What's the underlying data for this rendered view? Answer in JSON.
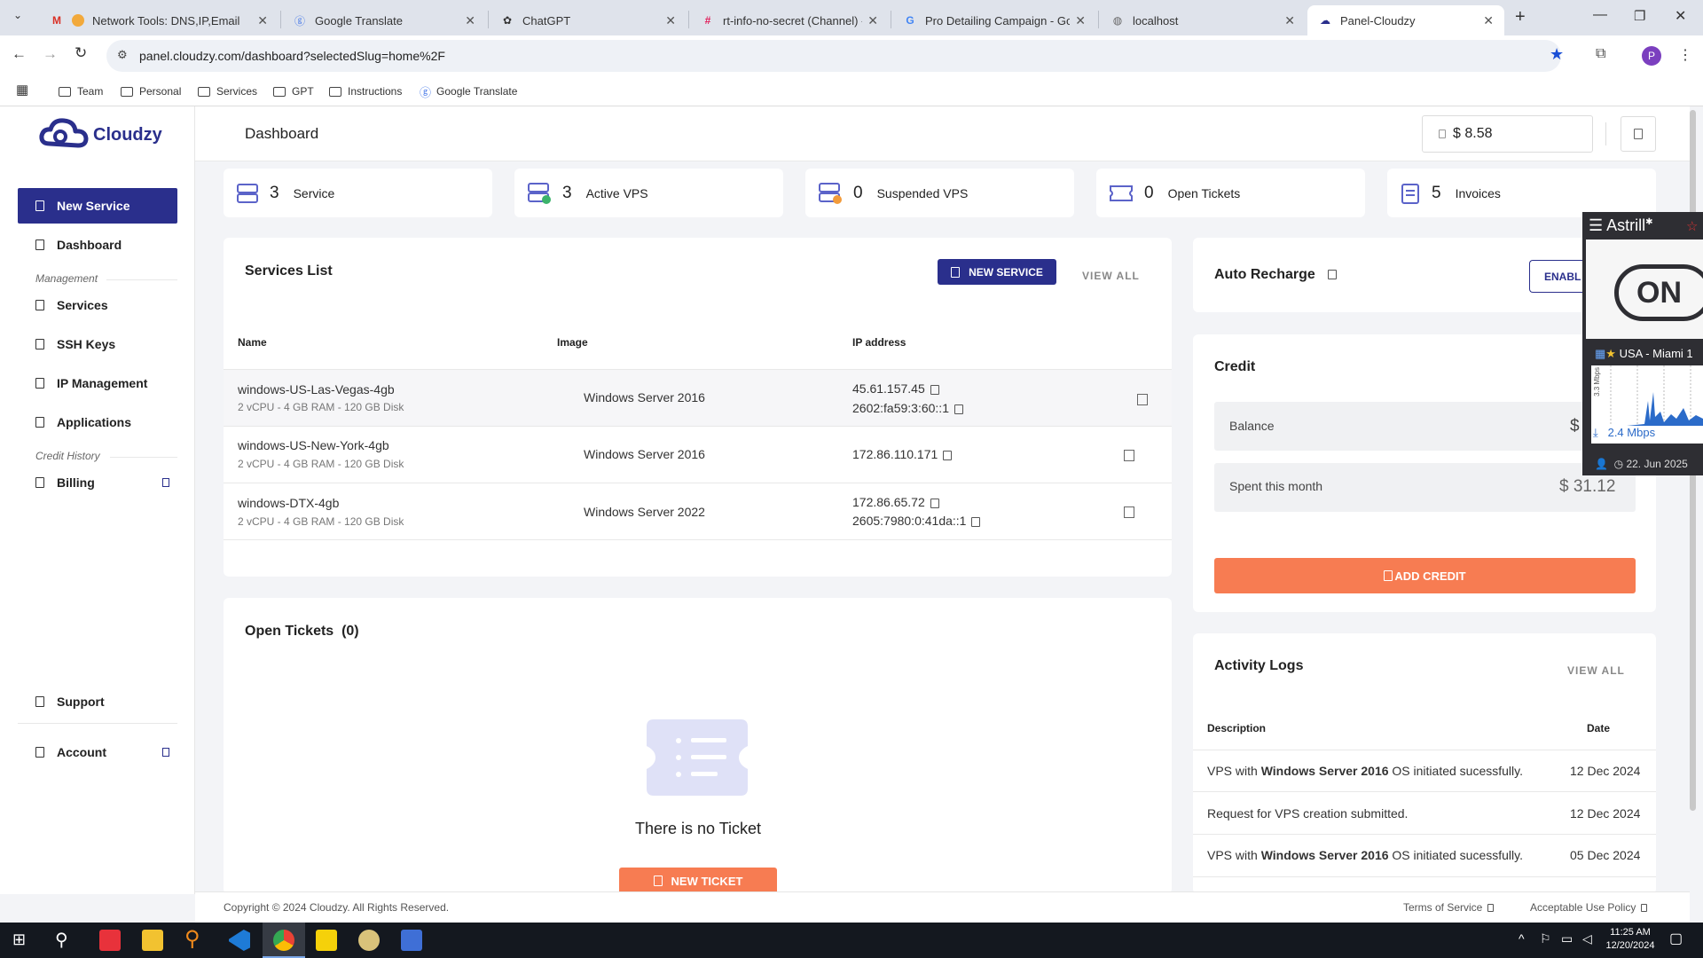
{
  "browser": {
    "tabs": [
      {
        "title": "Network Tools: DNS,IP,Email",
        "icon": "mx-toolbox-icon"
      },
      {
        "title": "Google Translate",
        "icon": "google-translate-icon"
      },
      {
        "title": "ChatGPT",
        "icon": "chatgpt-icon"
      },
      {
        "title": "rt-info-no-secret (Channel) - r",
        "icon": "slack-icon"
      },
      {
        "title": "Pro Detailing Campaign - Goo",
        "icon": "google-icon"
      },
      {
        "title": "localhost",
        "icon": "globe-icon"
      },
      {
        "title": "Panel-Cloudzy",
        "icon": "cloudzy-icon"
      }
    ],
    "url": "panel.cloudzy.com/dashboard?selectedSlug=home%2F",
    "profile_initial": "P",
    "bookmarks": [
      "Team",
      "Personal",
      "Services",
      "GPT",
      "Instructions",
      "Google Translate"
    ]
  },
  "app": {
    "logo_text": "Cloudzy",
    "page_title": "Dashboard",
    "balance_display": "$ 8.58",
    "accent": "#2a2f8c",
    "orange": "#f77c52"
  },
  "sidebar": {
    "new_service": "New Service",
    "dashboard": "Dashboard",
    "management_heading": "Management",
    "services": "Services",
    "ssh_keys": "SSH Keys",
    "ip_management": "IP Management",
    "applications": "Applications",
    "credit_heading": "Credit History",
    "billing": "Billing",
    "support": "Support",
    "account": "Account"
  },
  "stats": [
    {
      "value": "3",
      "label": "Service"
    },
    {
      "value": "3",
      "label": "Active VPS"
    },
    {
      "value": "0",
      "label": "Suspended VPS"
    },
    {
      "value": "0",
      "label": "Open Tickets"
    },
    {
      "value": "5",
      "label": "Invoices"
    }
  ],
  "services": {
    "title": "Services List",
    "new_button": "NEW SERVICE",
    "view_all": "VIEW ALL",
    "columns": [
      "Name",
      "Image",
      "IP address"
    ],
    "rows": [
      {
        "name": "windows-US-Las-Vegas-4gb",
        "specs": "2 vCPU - 4 GB RAM - 120 GB Disk",
        "image": "Windows Server 2016",
        "ip1": "45.61.157.45",
        "ip2": "2602:fa59:3:60::1"
      },
      {
        "name": "windows-US-New-York-4gb",
        "specs": "2 vCPU - 4 GB RAM - 120 GB Disk",
        "image": "Windows Server 2016",
        "ip1": "172.86.110.171",
        "ip2": ""
      },
      {
        "name": "windows-DTX-4gb",
        "specs": "2 vCPU - 4 GB RAM - 120 GB Disk",
        "image": "Windows Server 2022",
        "ip1": "172.86.65.72",
        "ip2": "2605:7980:0:41da::1"
      }
    ]
  },
  "tickets": {
    "title": "Open Tickets",
    "count": "(0)",
    "empty_text": "There is no Ticket",
    "new_button": "NEW TICKET"
  },
  "auto_recharge": {
    "title": "Auto Recharge",
    "button": "ENABL"
  },
  "credit": {
    "title": "Credit",
    "balance_label": "Balance",
    "balance_value": "$",
    "spent_label": "Spent this month",
    "spent_value": "$ 31.12",
    "add_button": "ADD CREDIT"
  },
  "activity": {
    "title": "Activity Logs",
    "view_all": "VIEW ALL",
    "col_desc": "Description",
    "col_date": "Date",
    "rows": [
      {
        "pre": "VPS with ",
        "bold": "Windows Server 2016",
        "post": " OS initiated sucessfully.",
        "date": "12 Dec 2024"
      },
      {
        "pre": "Request for VPS creation submitted.",
        "bold": "",
        "post": "",
        "date": "12 Dec 2024"
      },
      {
        "pre": "VPS with ",
        "bold": "Windows Server 2016",
        "post": " OS initiated sucessfully.",
        "date": "05 Dec 2024"
      }
    ]
  },
  "footer": {
    "copyright": "Copyright © 2024 Cloudzy. All Rights Reserved.",
    "terms": "Terms of Service",
    "aup": "Acceptable Use Policy"
  },
  "astrill": {
    "brand": "Astrill",
    "state": "ON",
    "location": "USA - Miami 1",
    "axis_label": "3.3 Mbps",
    "speed": "2.4 Mbps",
    "date": "22. Jun 2025"
  },
  "taskbar": {
    "time": "11:25 AM",
    "date": "12/20/2024"
  }
}
